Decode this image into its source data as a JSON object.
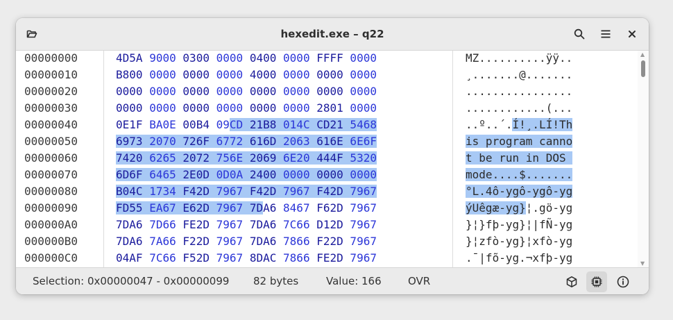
{
  "window": {
    "title": "hexedit.exe – q22"
  },
  "header_icons": {
    "open": "folder-open-icon",
    "search": "search-icon",
    "menu": "hamburger-menu-icon",
    "close": "close-icon"
  },
  "colors": {
    "selection": "#a8c9f5",
    "word_dark": "#1a1a9c",
    "word_bright": "#2b35d8"
  },
  "rows": [
    {
      "offset": "00000000",
      "words": [
        "4D5A",
        "9000",
        "0300",
        "0000",
        "0400",
        "0000",
        "FFFF",
        "0000"
      ],
      "ascii": "MZ..........ÿÿ.."
    },
    {
      "offset": "00000010",
      "words": [
        "B800",
        "0000",
        "0000",
        "0000",
        "4000",
        "0000",
        "0000",
        "0000"
      ],
      "ascii": "¸.......@......."
    },
    {
      "offset": "00000020",
      "words": [
        "0000",
        "0000",
        "0000",
        "0000",
        "0000",
        "0000",
        "0000",
        "0000"
      ],
      "ascii": "................"
    },
    {
      "offset": "00000030",
      "words": [
        "0000",
        "0000",
        "0000",
        "0000",
        "0000",
        "0000",
        "2801",
        "0000"
      ],
      "ascii": "............(..."
    },
    {
      "offset": "00000040",
      "words": [
        "0E1F",
        "BA0E",
        "00B4",
        "09CD",
        "21B8",
        "014C",
        "CD21",
        "5468"
      ],
      "ascii": "..º..´.Í!¸.LÍ!Th"
    },
    {
      "offset": "00000050",
      "words": [
        "6973",
        "2070",
        "726F",
        "6772",
        "616D",
        "2063",
        "616E",
        "6E6F"
      ],
      "ascii": "is program canno"
    },
    {
      "offset": "00000060",
      "words": [
        "7420",
        "6265",
        "2072",
        "756E",
        "2069",
        "6E20",
        "444F",
        "5320"
      ],
      "ascii": "t be run in DOS "
    },
    {
      "offset": "00000070",
      "words": [
        "6D6F",
        "6465",
        "2E0D",
        "0D0A",
        "2400",
        "0000",
        "0000",
        "0000"
      ],
      "ascii": "mode....$......."
    },
    {
      "offset": "00000080",
      "words": [
        "B04C",
        "1734",
        "F42D",
        "7967",
        "F42D",
        "7967",
        "F42D",
        "7967"
      ],
      "ascii": "°L.4ô-ygô-ygô-yg"
    },
    {
      "offset": "00000090",
      "words": [
        "FD55",
        "EA67",
        "E62D",
        "7967",
        "7DA6",
        "8467",
        "F62D",
        "7967"
      ],
      "ascii": "ýUêgæ-yg}¦.gö-yg"
    },
    {
      "offset": "000000A0",
      "words": [
        "7DA6",
        "7D66",
        "FE2D",
        "7967",
        "7DA6",
        "7C66",
        "D12D",
        "7967"
      ],
      "ascii": "}¦}fþ-yg}¦|fÑ-yg"
    },
    {
      "offset": "000000B0",
      "words": [
        "7DA6",
        "7A66",
        "F22D",
        "7967",
        "7DA6",
        "7866",
        "F22D",
        "7967"
      ],
      "ascii": "}¦zfò-yg}¦xfò-yg"
    },
    {
      "offset": "000000C0",
      "words": [
        "04AF",
        "7C66",
        "F52D",
        "7967",
        "8DAC",
        "7866",
        "FE2D",
        "7967"
      ],
      "ascii": ".¯|fõ-yg.¬xfþ-yg"
    }
  ],
  "selection": {
    "start": 71,
    "end": 153
  },
  "status": {
    "selection": "Selection: 0x00000047 - 0x00000099",
    "bytes": "82 bytes",
    "value": "Value: 166",
    "mode": "OVR"
  },
  "status_icons": {
    "cube": "cube-icon",
    "chip": "chip-icon",
    "info": "info-icon"
  }
}
